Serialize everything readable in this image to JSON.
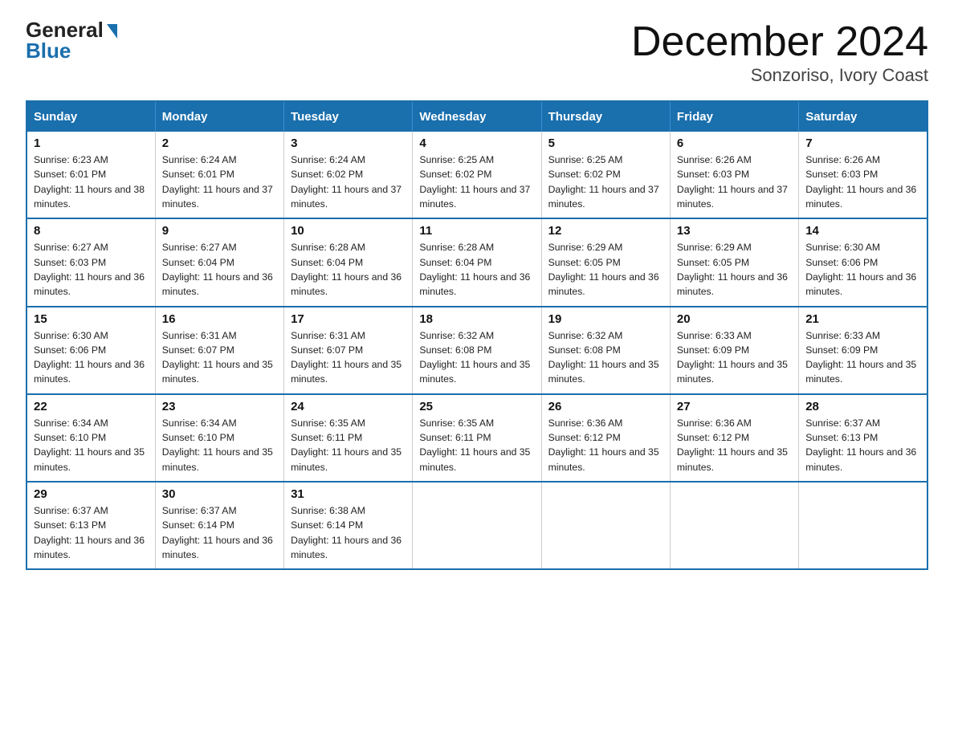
{
  "logo": {
    "general": "General",
    "blue": "Blue"
  },
  "title": "December 2024",
  "location": "Sonzoriso, Ivory Coast",
  "weekdays": [
    "Sunday",
    "Monday",
    "Tuesday",
    "Wednesday",
    "Thursday",
    "Friday",
    "Saturday"
  ],
  "weeks": [
    [
      {
        "day": "1",
        "sunrise": "6:23 AM",
        "sunset": "6:01 PM",
        "daylight": "11 hours and 38 minutes."
      },
      {
        "day": "2",
        "sunrise": "6:24 AM",
        "sunset": "6:01 PM",
        "daylight": "11 hours and 37 minutes."
      },
      {
        "day": "3",
        "sunrise": "6:24 AM",
        "sunset": "6:02 PM",
        "daylight": "11 hours and 37 minutes."
      },
      {
        "day": "4",
        "sunrise": "6:25 AM",
        "sunset": "6:02 PM",
        "daylight": "11 hours and 37 minutes."
      },
      {
        "day": "5",
        "sunrise": "6:25 AM",
        "sunset": "6:02 PM",
        "daylight": "11 hours and 37 minutes."
      },
      {
        "day": "6",
        "sunrise": "6:26 AM",
        "sunset": "6:03 PM",
        "daylight": "11 hours and 37 minutes."
      },
      {
        "day": "7",
        "sunrise": "6:26 AM",
        "sunset": "6:03 PM",
        "daylight": "11 hours and 36 minutes."
      }
    ],
    [
      {
        "day": "8",
        "sunrise": "6:27 AM",
        "sunset": "6:03 PM",
        "daylight": "11 hours and 36 minutes."
      },
      {
        "day": "9",
        "sunrise": "6:27 AM",
        "sunset": "6:04 PM",
        "daylight": "11 hours and 36 minutes."
      },
      {
        "day": "10",
        "sunrise": "6:28 AM",
        "sunset": "6:04 PM",
        "daylight": "11 hours and 36 minutes."
      },
      {
        "day": "11",
        "sunrise": "6:28 AM",
        "sunset": "6:04 PM",
        "daylight": "11 hours and 36 minutes."
      },
      {
        "day": "12",
        "sunrise": "6:29 AM",
        "sunset": "6:05 PM",
        "daylight": "11 hours and 36 minutes."
      },
      {
        "day": "13",
        "sunrise": "6:29 AM",
        "sunset": "6:05 PM",
        "daylight": "11 hours and 36 minutes."
      },
      {
        "day": "14",
        "sunrise": "6:30 AM",
        "sunset": "6:06 PM",
        "daylight": "11 hours and 36 minutes."
      }
    ],
    [
      {
        "day": "15",
        "sunrise": "6:30 AM",
        "sunset": "6:06 PM",
        "daylight": "11 hours and 36 minutes."
      },
      {
        "day": "16",
        "sunrise": "6:31 AM",
        "sunset": "6:07 PM",
        "daylight": "11 hours and 35 minutes."
      },
      {
        "day": "17",
        "sunrise": "6:31 AM",
        "sunset": "6:07 PM",
        "daylight": "11 hours and 35 minutes."
      },
      {
        "day": "18",
        "sunrise": "6:32 AM",
        "sunset": "6:08 PM",
        "daylight": "11 hours and 35 minutes."
      },
      {
        "day": "19",
        "sunrise": "6:32 AM",
        "sunset": "6:08 PM",
        "daylight": "11 hours and 35 minutes."
      },
      {
        "day": "20",
        "sunrise": "6:33 AM",
        "sunset": "6:09 PM",
        "daylight": "11 hours and 35 minutes."
      },
      {
        "day": "21",
        "sunrise": "6:33 AM",
        "sunset": "6:09 PM",
        "daylight": "11 hours and 35 minutes."
      }
    ],
    [
      {
        "day": "22",
        "sunrise": "6:34 AM",
        "sunset": "6:10 PM",
        "daylight": "11 hours and 35 minutes."
      },
      {
        "day": "23",
        "sunrise": "6:34 AM",
        "sunset": "6:10 PM",
        "daylight": "11 hours and 35 minutes."
      },
      {
        "day": "24",
        "sunrise": "6:35 AM",
        "sunset": "6:11 PM",
        "daylight": "11 hours and 35 minutes."
      },
      {
        "day": "25",
        "sunrise": "6:35 AM",
        "sunset": "6:11 PM",
        "daylight": "11 hours and 35 minutes."
      },
      {
        "day": "26",
        "sunrise": "6:36 AM",
        "sunset": "6:12 PM",
        "daylight": "11 hours and 35 minutes."
      },
      {
        "day": "27",
        "sunrise": "6:36 AM",
        "sunset": "6:12 PM",
        "daylight": "11 hours and 35 minutes."
      },
      {
        "day": "28",
        "sunrise": "6:37 AM",
        "sunset": "6:13 PM",
        "daylight": "11 hours and 36 minutes."
      }
    ],
    [
      {
        "day": "29",
        "sunrise": "6:37 AM",
        "sunset": "6:13 PM",
        "daylight": "11 hours and 36 minutes."
      },
      {
        "day": "30",
        "sunrise": "6:37 AM",
        "sunset": "6:14 PM",
        "daylight": "11 hours and 36 minutes."
      },
      {
        "day": "31",
        "sunrise": "6:38 AM",
        "sunset": "6:14 PM",
        "daylight": "11 hours and 36 minutes."
      },
      null,
      null,
      null,
      null
    ]
  ]
}
